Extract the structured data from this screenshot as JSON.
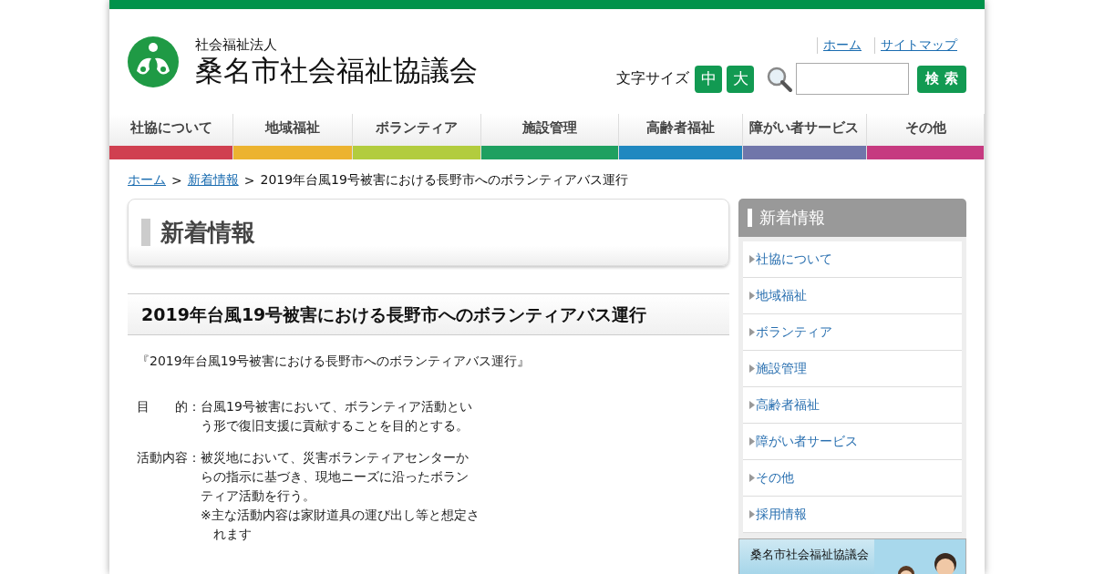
{
  "header": {
    "subtitle": "社会福祉法人",
    "title": "桑名市社会福祉協議会"
  },
  "top_links": [
    {
      "label": "ホーム"
    },
    {
      "label": "サイトマップ"
    }
  ],
  "font_size": {
    "label": "文字サイズ",
    "buttons": [
      {
        "label": "中"
      },
      {
        "label": "大"
      }
    ]
  },
  "search": {
    "button": "検 索"
  },
  "nav": [
    {
      "label": "社協について",
      "color": "#d04050"
    },
    {
      "label": "地域福祉",
      "color": "#ecb330"
    },
    {
      "label": "ボランティア",
      "color": "#b2cc3e"
    },
    {
      "label": "施設管理",
      "color": "#1ea060"
    },
    {
      "label": "高齢者福祉",
      "color": "#2088c0"
    },
    {
      "label": "障がい者サービス",
      "color": "#7076aa"
    },
    {
      "label": "その他",
      "color": "#c63a80"
    }
  ],
  "breadcrumb": [
    {
      "label": "ホーム",
      "link": true
    },
    {
      "label": "新着情報",
      "link": true
    },
    {
      "label": "2019年台風19号被害における長野市へのボランティアバス運行",
      "link": false
    }
  ],
  "breadcrumb_separator": ">",
  "page_title": "新着情報",
  "article": {
    "title": "2019年台風19号被害における長野市へのボランティアバス運行",
    "intro": "『2019年台風19号被害における長野市へのボランティアバス運行』",
    "details": [
      {
        "label": "目　　的",
        "colon": "：",
        "paragraphs": [
          {
            "text": "台風19号被害において、ボランティア活動という形で復旧支援に貢献することを目的とする。",
            "kind": "plain"
          }
        ]
      },
      {
        "label": "活動内容",
        "colon": "：",
        "paragraphs": [
          {
            "text": "被災地において、災害ボランティアセンターからの指示に基づき、現地ニーズに沿ったボランティア活動を行う。",
            "kind": "plain"
          },
          {
            "text": "※主な活動内容は家財道具の運び出し等と想定されます",
            "kind": "note"
          }
        ]
      }
    ]
  },
  "sidebar": {
    "title": "新着情報",
    "items": [
      {
        "label": "社協について"
      },
      {
        "label": "地域福祉"
      },
      {
        "label": "ボランティア"
      },
      {
        "label": "施設管理"
      },
      {
        "label": "高齢者福祉"
      },
      {
        "label": "障がい者サービス"
      },
      {
        "label": "その他"
      },
      {
        "label": "採用情報"
      }
    ],
    "banner": {
      "caption": "桑名市社会福祉協議会"
    }
  }
}
